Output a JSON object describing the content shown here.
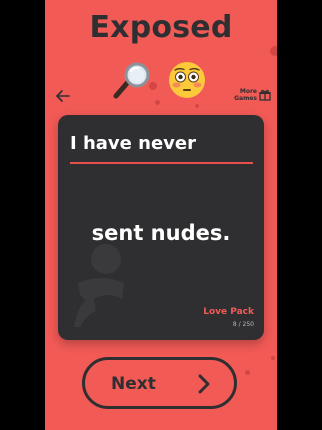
{
  "app": {
    "title": "Exposed",
    "accent_color": "#f25a56",
    "card_color": "#2f2f31"
  },
  "header": {
    "emojis": [
      "magnifying-glass-icon",
      "flushed-face-icon"
    ],
    "back_icon": "back-arrow-icon",
    "more_games_label": "More Games",
    "more_games_icon": "gift-icon"
  },
  "card": {
    "heading": "I have never",
    "statement": "sent nudes.",
    "pack_name": "Love Pack",
    "progress": "8 / 250"
  },
  "footer": {
    "next_label": "Next",
    "next_icon": "chevron-right-icon"
  }
}
